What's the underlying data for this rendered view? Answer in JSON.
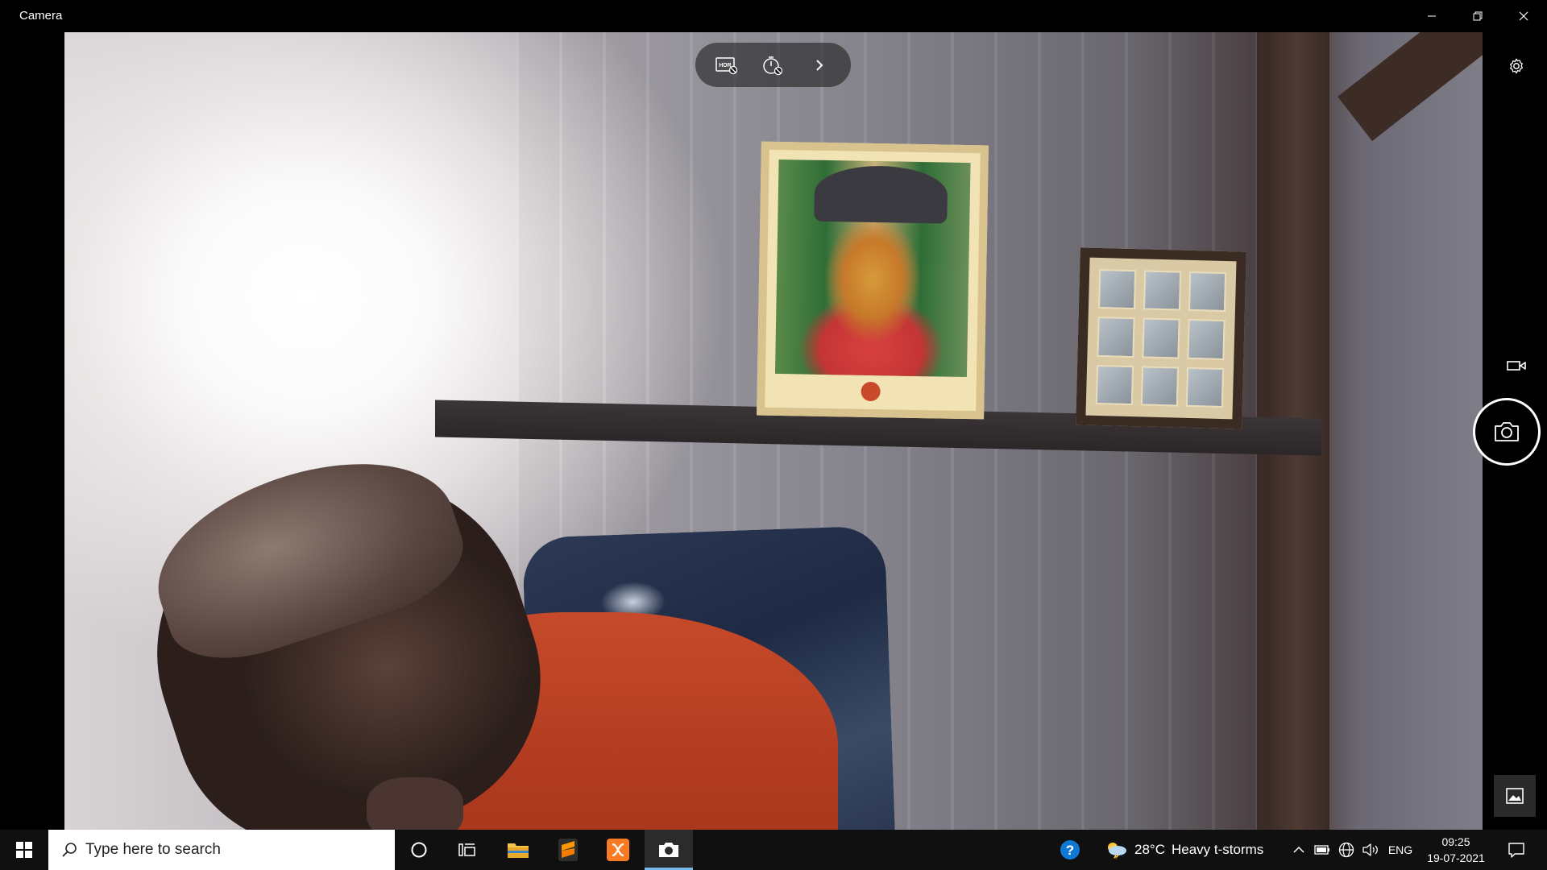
{
  "window": {
    "title": "Camera",
    "controls": {
      "minimize": "minimize-icon",
      "restore": "restore-icon",
      "close": "close-icon"
    }
  },
  "camera_toolbar": {
    "icons": [
      "hdr-icon",
      "timer-icon",
      "chevron-right-icon"
    ]
  },
  "right_rail": {
    "settings": "gear-icon",
    "mode": "video-icon",
    "shutter": "camera-icon",
    "gallery": "image-icon"
  },
  "taskbar": {
    "search_placeholder": "Type here to search",
    "apps": [
      "cortana-icon",
      "task-view-icon",
      "file-explorer-icon",
      "sublime-text-icon",
      "xampp-icon",
      "camera-app-icon"
    ],
    "weather": {
      "temperature": "28°C",
      "condition": "Heavy t-storms"
    },
    "language": "ENG",
    "time": "09:25",
    "date": "19-07-2021"
  },
  "colors": {
    "accent": "#76b9ed",
    "taskbar_bg": "#101010",
    "titlebar_bg": "#000000"
  }
}
